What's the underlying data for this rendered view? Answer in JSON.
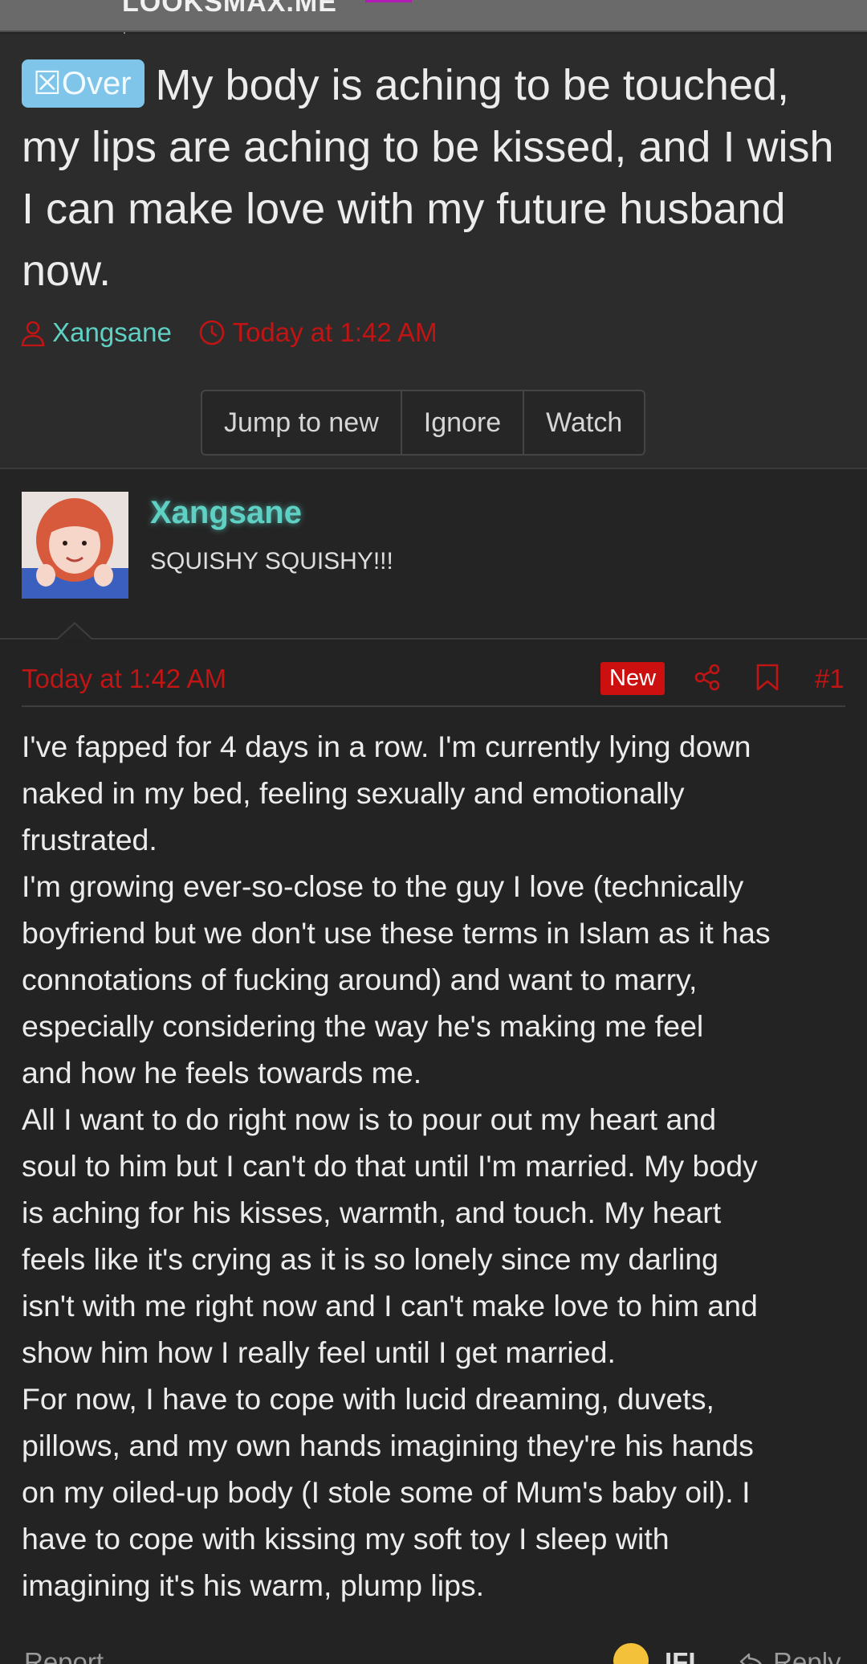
{
  "site": {
    "logo": "LOOKSMAX.ME"
  },
  "thread": {
    "prefix": "☒Over",
    "title": "My body is aching to be touched, my lips are aching to be kissed, and I wish I can make love with my future husband now.",
    "author": "Xangsane",
    "date": "Today at 1:42 AM",
    "buttons": {
      "jump": "Jump to new",
      "ignore": "Ignore",
      "watch": "Watch"
    }
  },
  "user": {
    "name": "Xangsane",
    "title": "SQUISHY SQUISHY!!!"
  },
  "post": {
    "date": "Today at 1:42 AM",
    "badge": "New",
    "number": "#1",
    "lines": [
      "I've fapped for 4 days in a row. I'm currently lying down",
      "naked in my bed, feeling sexually and emotionally",
      "frustrated.",
      "I'm growing ever-so-close to the guy I love (technically",
      "boyfriend but we don't use these terms in Islam as it has",
      "connotations of fucking around) and want to marry,",
      "especially considering the way   he's making me feel",
      "and how   he feels towards me.",
      "All I want to do right now is to pour out my heart and",
      "soul to him but I can't do that until I'm married. My body",
      "is aching for his kisses, warmth, and touch. My heart",
      "feels like it's crying as it is so lonely since my darling",
      "isn't with me right now and I can't make love to him and",
      "show him how I really feel until I get married.",
      "For now, I have to cope with lucid dreaming, duvets,",
      "pillows, and my own hands imagining they're his hands",
      "on my oiled-up body (I stole some of Mum's baby oil). I",
      "have to cope with kissing my soft toy I sleep with",
      "imagining it's his warm, plump lips."
    ]
  },
  "footer": {
    "report": "Report",
    "reaction": "IFL",
    "reply": "Reply"
  },
  "colors": {
    "author": "#5fd1c4",
    "date": "#c11414",
    "prefix_bg": "#7fc5ea",
    "badge_bg": "#cc1010"
  }
}
